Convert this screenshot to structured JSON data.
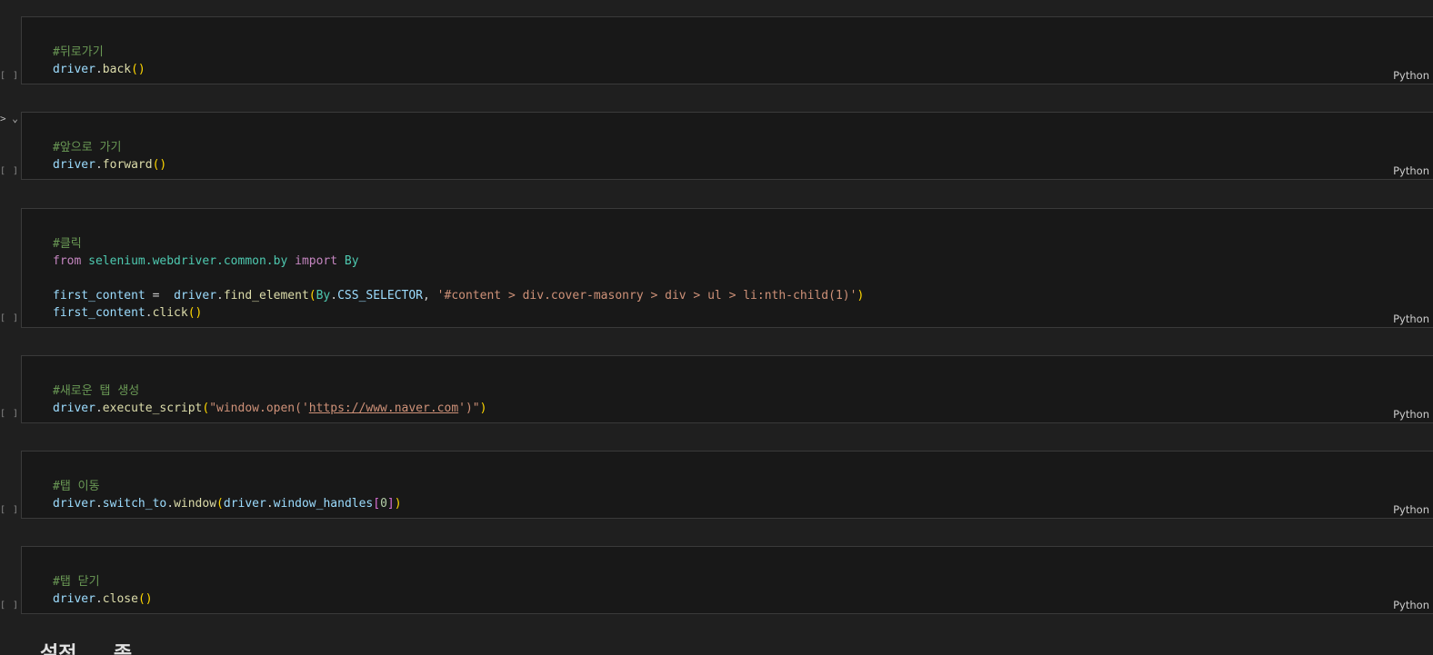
{
  "language_label": "Python",
  "exec_count_label": "[ ]",
  "cells": [
    {
      "comment": "#뒤로가기",
      "obj": "driver",
      "method": "back"
    },
    {
      "comment": "#앞으로 가기",
      "obj": "driver",
      "method": "forward"
    },
    {
      "comment": "#클릭",
      "import": {
        "from_kw": "from",
        "module": "selenium.webdriver.common.by",
        "import_kw": "import",
        "name": "By"
      },
      "assign_var": "first_content",
      "obj": "driver",
      "method": "find_element",
      "by": "By",
      "by_attr": "CSS_SELECTOR",
      "selector": "'#content > div.cover-masonry > div > ul > li:nth-child(1)'",
      "click_method": "click"
    },
    {
      "comment": "#새로운 탭 생성",
      "obj": "driver",
      "method": "execute_script",
      "str_start": "\"window.open('",
      "url": "https://www.naver.com",
      "str_end": "')\""
    },
    {
      "comment": "#탭 이동",
      "obj": "driver",
      "chain": "switch_to",
      "method": "window",
      "arg_obj": "driver",
      "arg_attr": "window_handles",
      "index": "0"
    },
    {
      "comment": "#탭 닫기",
      "obj": "driver",
      "method": "close"
    }
  ],
  "next_markdown_heading": "설정 ... 종"
}
